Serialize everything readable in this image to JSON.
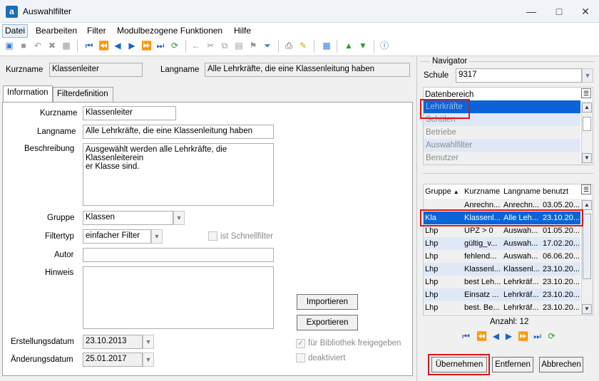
{
  "window": {
    "title": "Auswahlfilter",
    "app_icon": "a"
  },
  "menu": [
    "Datei",
    "Bearbeiten",
    "Filter",
    "Modulbezogene Funktionen",
    "Hilfe"
  ],
  "header": {
    "kurzname_label": "Kurzname",
    "kurzname_value": "Klassenleiter",
    "langname_label": "Langname",
    "langname_value": "Alle Lehrkräfte, die eine Klassenleitung haben"
  },
  "tabs": [
    "Information",
    "Filterdefinition"
  ],
  "info": {
    "kurzname_label": "Kurzname",
    "kurzname_value": "Klassenleiter",
    "langname_label": "Langname",
    "langname_value": "Alle Lehrkräfte, die eine Klassenleitung haben",
    "beschreibung_label": "Beschreibung",
    "beschreibung_line1": "Ausgewählt werden alle Lehrkräfte, die Klassenleiterein",
    "beschreibung_line2": "er Klasse sind.",
    "gruppe_label": "Gruppe",
    "gruppe_value": "Klassen",
    "filtertyp_label": "Filtertyp",
    "filtertyp_value": "einfacher Filter",
    "schnellfilter_label": "ist Schnellfilter",
    "autor_label": "Autor",
    "autor_value": "",
    "hinweis_label": "Hinweis",
    "importieren": "Importieren",
    "exportieren": "Exportieren",
    "erstellungsdatum_label": "Erstellungsdatum",
    "erstellungsdatum_value": "23.10.2013",
    "aenderungsdatum_label": "Änderungsdatum",
    "aenderungsdatum_value": "25.01.2017",
    "bibliothek_label": "für Bibliothek freigegeben",
    "deaktiviert_label": "deaktiviert"
  },
  "navigator": {
    "title": "Navigator",
    "schule_label": "Schule",
    "schule_value": "9317",
    "datenbereich_label": "Datenbereich",
    "datenbereich_items": [
      "Lehrkräfte",
      "Schülen",
      "Betriebe",
      "Auswahlfilter",
      "Benutzer"
    ],
    "grid_headers": [
      "Gruppe",
      "Kurzname",
      "Langname",
      "benutzt"
    ],
    "rows": [
      [
        "",
        "Anrechn...",
        "Anrechn...",
        "03.05.20..."
      ],
      [
        "Kla",
        "Klassenl...",
        "Alle Leh...",
        "23.10.20..."
      ],
      [
        "Lhp",
        "UPZ > 0",
        "Auswah...",
        "01.05.20..."
      ],
      [
        "Lhp",
        "gültig_v...",
        "Auswah...",
        "17.02.20..."
      ],
      [
        "Lhp",
        "fehlend...",
        "Auswah...",
        "06.06.20..."
      ],
      [
        "Lhp",
        "Klassenl...",
        "Klassenl...",
        "23.10.20..."
      ],
      [
        "Lhp",
        "best Leh...",
        "Lehrkräf...",
        "23.10.20..."
      ],
      [
        "Lhp",
        "Einsatz ...",
        "Lehrkräf...",
        "23.10.20..."
      ],
      [
        "Lhp",
        "best. Be...",
        "Lehrkräf...",
        "23.10.20..."
      ]
    ],
    "anzahl": "Anzahl: 12",
    "buttons": {
      "uebernehmen": "Übernehmen",
      "entfernen": "Entfernen",
      "abbrechen": "Abbrechen"
    }
  },
  "colors": {
    "selection": "#0a64d8",
    "highlight": "#cfe0f7",
    "red_marker": "#e01414"
  }
}
